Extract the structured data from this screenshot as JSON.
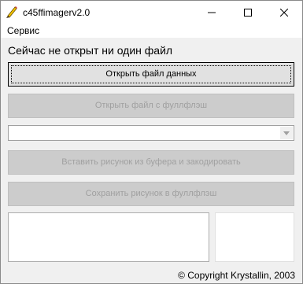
{
  "window": {
    "title": "c45ffimagerv2.0",
    "controls": {
      "minimize": "minimize-icon",
      "maximize": "maximize-icon",
      "close": "close-icon"
    }
  },
  "menu": {
    "items": [
      "Сервис"
    ]
  },
  "main": {
    "status": "Сейчас не открыт ни один файл",
    "open_data_label": "Открыть файл данных",
    "open_fullflash_label": "Открыть файл с фуллфлэш",
    "combo_value": "",
    "paste_encode_label": "Вставить рисунок из буфера и закодировать",
    "save_fullflash_label": "Сохранить рисунок в фуллфлэш"
  },
  "footer": {
    "copyright": "© Copyright Krystallin, 2003"
  },
  "colors": {
    "window_bg": "#f0f0f0",
    "disabled_text": "#a0a0a0",
    "button_bg": "#e1e1e1"
  }
}
